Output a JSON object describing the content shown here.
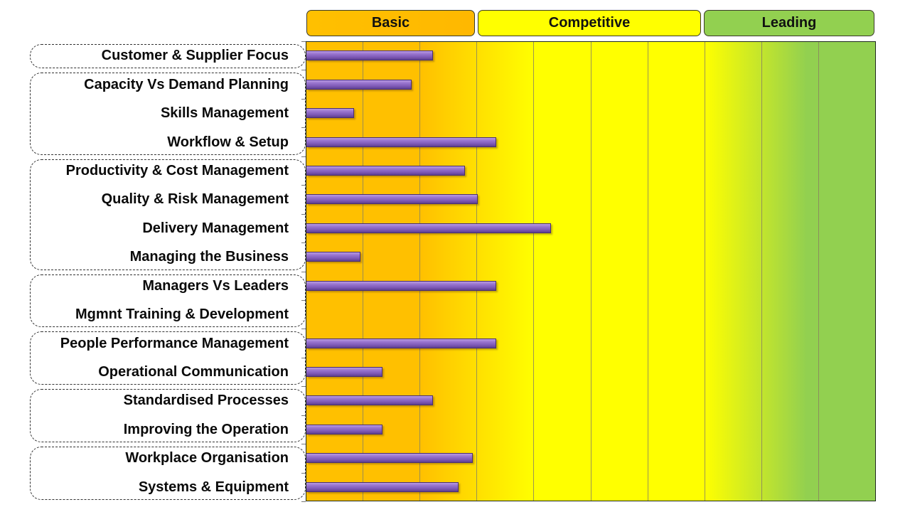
{
  "chart_data": {
    "type": "bar",
    "orientation": "horizontal",
    "title": "",
    "xlabel": "",
    "ylabel": "",
    "xlim": [
      0,
      10
    ],
    "x_gridlines": [
      1,
      2,
      3,
      4,
      5,
      6,
      7,
      8,
      9
    ],
    "bands": [
      {
        "label": "Basic",
        "range": [
          0,
          3
        ],
        "color": "#FFC000"
      },
      {
        "label": "Competitive",
        "range": [
          3,
          7
        ],
        "color": "#FFFF00"
      },
      {
        "label": "Leading",
        "range": [
          7,
          10
        ],
        "color": "#92D050"
      }
    ],
    "categories": [
      "Customer & Supplier Focus",
      "Capacity Vs Demand Planning",
      "Skills Management",
      "Workflow & Setup",
      "Productivity & Cost Management",
      "Quality & Risk Management",
      "Delivery Management",
      "Managing the Business",
      "Managers Vs Leaders",
      "Mgmnt Training & Development",
      "People Performance Management",
      "Operational Communication",
      "Standardised Processes",
      "Improving the Operation",
      "Workplace Organisation",
      "Systems & Equipment"
    ],
    "values": [
      2.22,
      1.85,
      0.83,
      3.33,
      2.78,
      3.0,
      4.29,
      0.95,
      3.33,
      0,
      3.33,
      1.33,
      2.22,
      1.33,
      2.92,
      2.67
    ],
    "groups": [
      {
        "start": 0,
        "end": 0
      },
      {
        "start": 1,
        "end": 3
      },
      {
        "start": 4,
        "end": 7
      },
      {
        "start": 8,
        "end": 9
      },
      {
        "start": 10,
        "end": 11
      },
      {
        "start": 12,
        "end": 13
      },
      {
        "start": 14,
        "end": 15
      }
    ],
    "bar_color": "#8064A2",
    "grid": true,
    "legend": "none"
  }
}
